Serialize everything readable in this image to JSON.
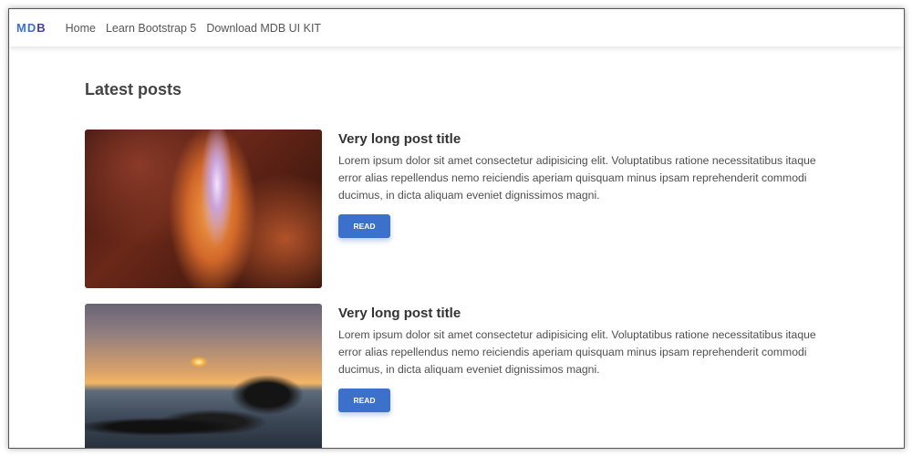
{
  "navbar": {
    "brand": {
      "main": "MD",
      "last": "B"
    },
    "links": [
      "Home",
      "Learn Bootstrap 5",
      "Download MDB UI KIT"
    ]
  },
  "main": {
    "heading": "Latest posts",
    "posts": [
      {
        "title": "Very long post title",
        "text": "Lorem ipsum dolor sit amet consectetur adipisicing elit. Voluptatibus ratione necessitatibus itaque error alias repellendus nemo reiciendis aperiam quisquam minus ipsam reprehenderit commodi ducimus, in dicta aliquam eveniet dignissimos magni.",
        "button": "READ",
        "image": "canyon"
      },
      {
        "title": "Very long post title",
        "text": "Lorem ipsum dolor sit amet consectetur adipisicing elit. Voluptatibus ratione necessitatibus itaque error alias repellendus nemo reiciendis aperiam quisquam minus ipsam reprehenderit commodi ducimus, in dicta aliquam eveniet dignissimos magni.",
        "button": "READ",
        "image": "sunset"
      }
    ]
  },
  "colors": {
    "primary": "#3b71ca"
  }
}
